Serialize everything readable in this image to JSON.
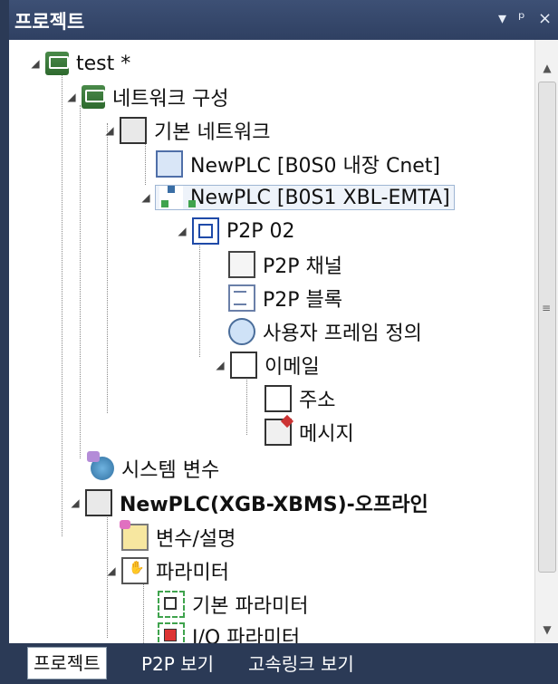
{
  "panel": {
    "title": "프로젝트",
    "controls": {
      "dropdown": "▾",
      "pin": "ᵖ",
      "close": "×"
    }
  },
  "tree": {
    "root": "test *",
    "network_config": "네트워크 구성",
    "basic_network": "기본 네트워크",
    "plc_cnet": "NewPLC [B0S0 내장 Cnet]",
    "plc_emta": "NewPLC [B0S1 XBL-EMTA]",
    "p2p_02": "P2P 02",
    "p2p_channel": "P2P 채널",
    "p2p_block": "P2P 블록",
    "user_frame": "사용자 프레임 정의",
    "email": "이메일",
    "address": "주소",
    "message": "메시지",
    "system_vars": "시스템 변수",
    "plc_offline": "NewPLC(XGB-XBMS)-오프라인",
    "var_desc": "변수/설명",
    "parameter": "파라미터",
    "basic_param": "기본 파라미터",
    "io_param": "I/O 파라미터"
  },
  "tabs": {
    "project": "프로젝트",
    "p2p_view": "P2P 보기",
    "fast_link_view": "고속링크 보기"
  },
  "icons": {
    "network": "network-icon",
    "cube": "cube-icon",
    "plc": "plc-icon",
    "hub": "hub-icon",
    "p2p": "p2p-icon",
    "channel": "channel-icon",
    "block": "block-icon",
    "user": "user-frame-icon",
    "mail": "email-icon",
    "book": "address-book-icon",
    "message": "message-icon",
    "system": "system-variable-icon",
    "variable": "variable-icon",
    "parameter": "parameter-icon",
    "basic_param": "basic-parameter-icon",
    "io_param": "io-parameter-icon"
  },
  "colors": {
    "titlebar": "#2f4062",
    "selection": "#eef3fa",
    "tab_bg": "#2b3a56"
  }
}
